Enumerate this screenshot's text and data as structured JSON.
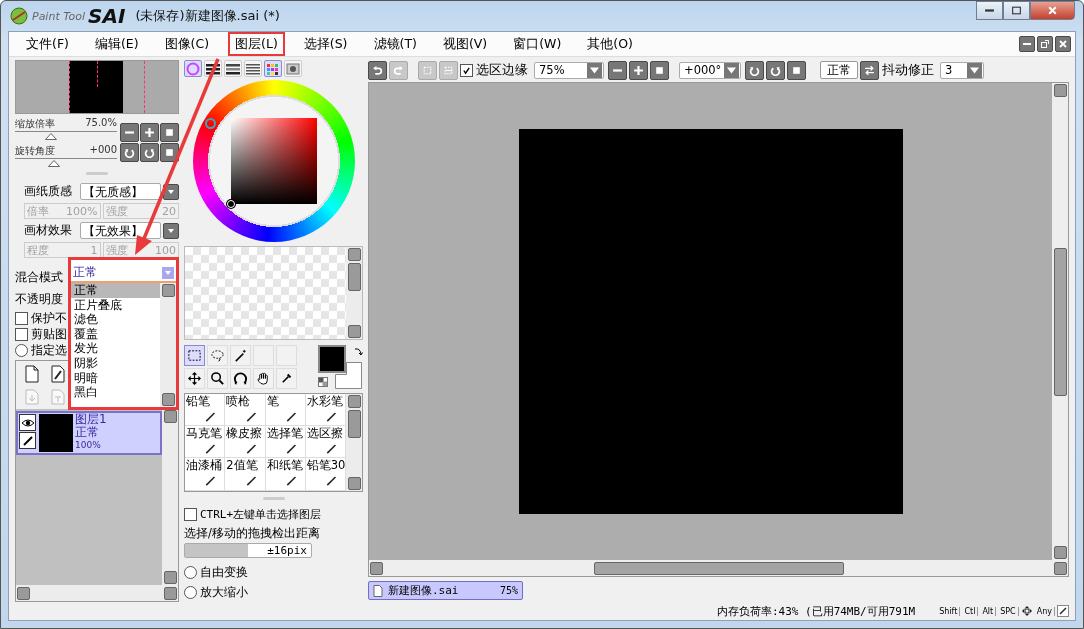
{
  "window": {
    "logo_text": "Paint Tool",
    "logo_brand": "SAI",
    "title": "(未保存)新建图像.sai (*)"
  },
  "menu": [
    {
      "label": "文件(F)",
      "highlighted": false
    },
    {
      "label": "编辑(E)",
      "highlighted": false
    },
    {
      "label": "图像(C)",
      "highlighted": false
    },
    {
      "label": "图层(L)",
      "highlighted": true
    },
    {
      "label": "选择(S)",
      "highlighted": false
    },
    {
      "label": "滤镜(T)",
      "highlighted": false
    },
    {
      "label": "视图(V)",
      "highlighted": false
    },
    {
      "label": "窗口(W)",
      "highlighted": false
    },
    {
      "label": "其他(O)",
      "highlighted": false
    }
  ],
  "navigator": [
    {
      "label": "缩放倍率",
      "reading": "75.0%",
      "level": 0.35
    },
    {
      "label": "旋转角度",
      "reading": "+000",
      "level": 0.38
    }
  ],
  "effects": [
    {
      "label": "画纸质感",
      "value": "【无质感】",
      "params": [
        {
          "label": "倍率",
          "value": "100%",
          "disabled": true
        },
        {
          "label": "强度",
          "value": "20",
          "disabled": true
        }
      ]
    },
    {
      "label": "画材效果",
      "value": "【无效果】",
      "params": [
        {
          "label": "程度",
          "value": "1",
          "disabled": true
        },
        {
          "label": "强度",
          "value": "100",
          "disabled": true
        }
      ]
    }
  ],
  "blend": {
    "label": "混合模式",
    "value": "正常",
    "open": true,
    "highlighted": true,
    "options": [
      {
        "label": "正常",
        "selected": true
      },
      {
        "label": "正片叠底",
        "selected": false
      },
      {
        "label": "滤色",
        "selected": false
      },
      {
        "label": "覆盖",
        "selected": false
      },
      {
        "label": "发光",
        "selected": false
      },
      {
        "label": "阴影",
        "selected": false
      },
      {
        "label": "明暗",
        "selected": false
      },
      {
        "label": "黑白",
        "selected": false
      }
    ]
  },
  "opacity": {
    "label": "不透明度"
  },
  "layer_options": [
    {
      "kind": "checkbox",
      "label": "保护不",
      "checked": false
    },
    {
      "kind": "checkbox",
      "label": "剪贴图",
      "checked": false
    },
    {
      "kind": "radio",
      "label": "指定选",
      "checked": false
    }
  ],
  "layers": [
    {
      "name": "图层1",
      "mode": "正常",
      "opacity": "100%",
      "selected": true,
      "visible": true
    }
  ],
  "color_modes": [
    {
      "kind": "wheel",
      "selected": true
    },
    {
      "kind": "rgb",
      "selected": false
    },
    {
      "kind": "hsv",
      "selected": false
    },
    {
      "kind": "bars",
      "selected": false
    },
    {
      "kind": "palette",
      "selected": true
    },
    {
      "kind": "scratch",
      "selected": false
    }
  ],
  "tools": [
    {
      "kind": "rect",
      "selected": true
    },
    {
      "kind": "lasso",
      "selected": false
    },
    {
      "kind": "wand",
      "selected": false
    },
    {
      "kind": "empty",
      "selected": false
    },
    {
      "kind": "empty",
      "selected": false
    },
    {
      "kind": "move",
      "selected": false
    },
    {
      "kind": "zoom",
      "selected": false
    },
    {
      "kind": "rotate",
      "selected": false
    },
    {
      "kind": "hand",
      "selected": false
    },
    {
      "kind": "picker",
      "selected": false
    }
  ],
  "brushes": [
    {
      "label": "铅笔"
    },
    {
      "label": "喷枪"
    },
    {
      "label": "笔"
    },
    {
      "label": "水彩笔"
    },
    {
      "label": "马克笔"
    },
    {
      "label": "橡皮擦"
    },
    {
      "label": "选择笔"
    },
    {
      "label": "选区擦"
    },
    {
      "label": "油漆桶"
    },
    {
      "label": "2值笔"
    },
    {
      "label": "和纸笔"
    },
    {
      "label": "铅笔30"
    }
  ],
  "ctrl_select": {
    "label": "CTRL+左键单击选择图层",
    "checked": false
  },
  "drag_distance": {
    "label": "选择/移动的拖拽检出距离",
    "reading": "±16pix",
    "level": 0.5
  },
  "transform_modes": [
    {
      "label": "自由变换",
      "selected": false
    },
    {
      "label": "放大缩小",
      "selected": false
    }
  ],
  "toolbar": {
    "edge_label": "选区边缘",
    "edge_checked": true,
    "zoom": "75%",
    "rotation": "+000°",
    "mode": "正常",
    "stabilizer_label": "抖动修正",
    "stabilizer": "3"
  },
  "canvas_tabs": [
    {
      "label": "新建图像.sai",
      "zoom": "75%",
      "selected": true
    }
  ],
  "status": {
    "memory": "内存负荷率:43% (已用74MB/可用791M",
    "keys": [
      {
        "kind": "key",
        "label": "Shift"
      },
      {
        "kind": "key",
        "label": "Ctl"
      },
      {
        "kind": "key",
        "label": "Alt"
      },
      {
        "kind": "key",
        "label": "SPC"
      },
      {
        "kind": "move"
      },
      {
        "kind": "key",
        "label": "Any"
      },
      {
        "kind": "pen"
      }
    ]
  }
}
